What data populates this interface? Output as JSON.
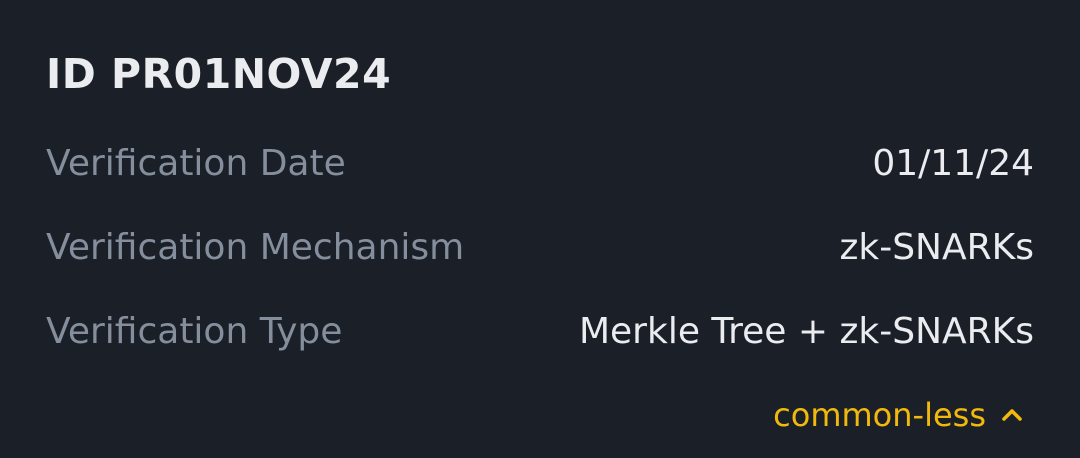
{
  "card": {
    "title": "ID PR01NOV24",
    "rows": [
      {
        "label": "Verification Date",
        "value": "01/11/24"
      },
      {
        "label": "Verification Mechanism",
        "value": "zk-SNARKs"
      },
      {
        "label": "Verification Type",
        "value": "Merkle Tree + zk-SNARKs"
      }
    ],
    "toggle": {
      "label": "common-less",
      "icon": "chevron-up-icon"
    }
  },
  "colors": {
    "background": "#1b1f27",
    "title": "#eaecef",
    "label": "#848e9c",
    "value": "#eaecef",
    "accent": "#f0b90b"
  }
}
